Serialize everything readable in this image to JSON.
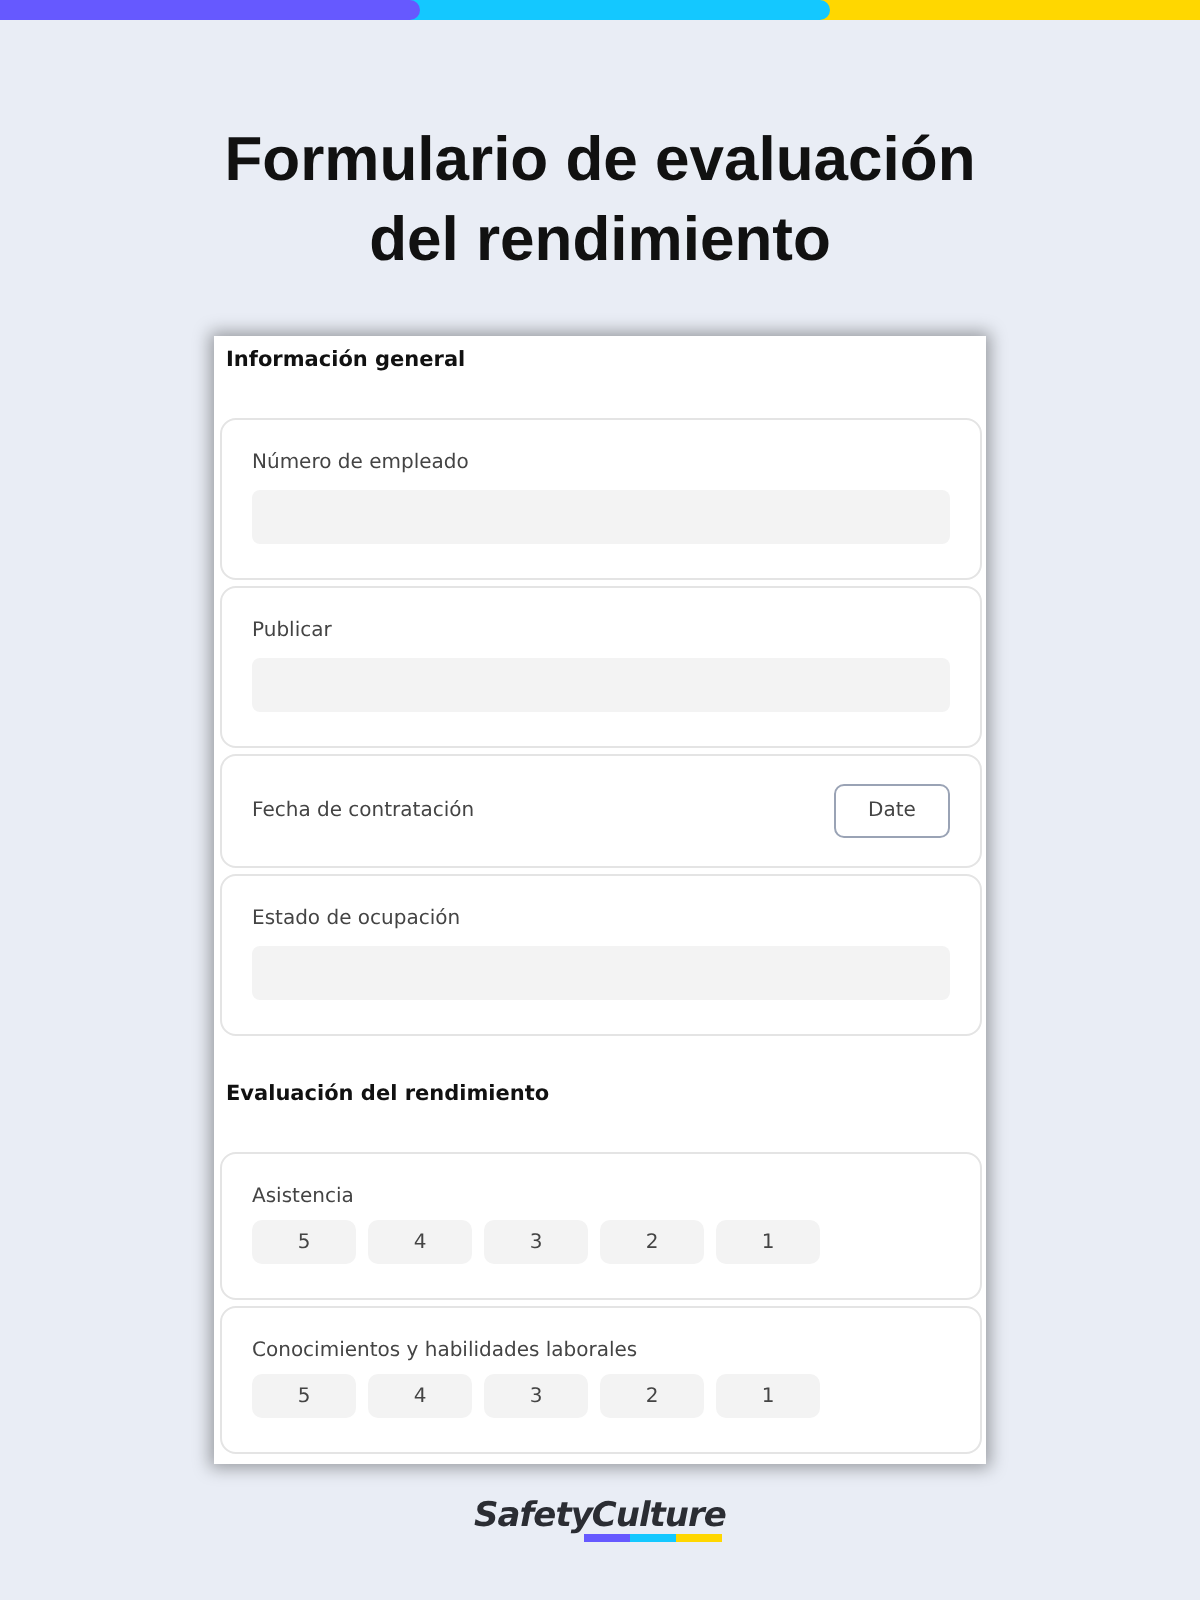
{
  "title": [
    "Formulario de evaluación",
    "del rendimiento"
  ],
  "sections": [
    {
      "heading": "Información general",
      "items": [
        {
          "kind": "text",
          "label": "Número de empleado"
        },
        {
          "kind": "text",
          "label": "Publicar"
        },
        {
          "kind": "date",
          "label": "Fecha de contratación",
          "button": "Date"
        },
        {
          "kind": "text",
          "label": "Estado de ocupación"
        }
      ]
    },
    {
      "heading": "Evaluación del rendimiento",
      "items": [
        {
          "kind": "rating",
          "label": "Asistencia",
          "options": [
            "5",
            "4",
            "3",
            "2",
            "1"
          ]
        },
        {
          "kind": "rating",
          "label": "Conocimientos y habilidades laborales",
          "options": [
            "5",
            "4",
            "3",
            "2",
            "1"
          ]
        }
      ]
    }
  ],
  "logo": "SafetyCulture"
}
